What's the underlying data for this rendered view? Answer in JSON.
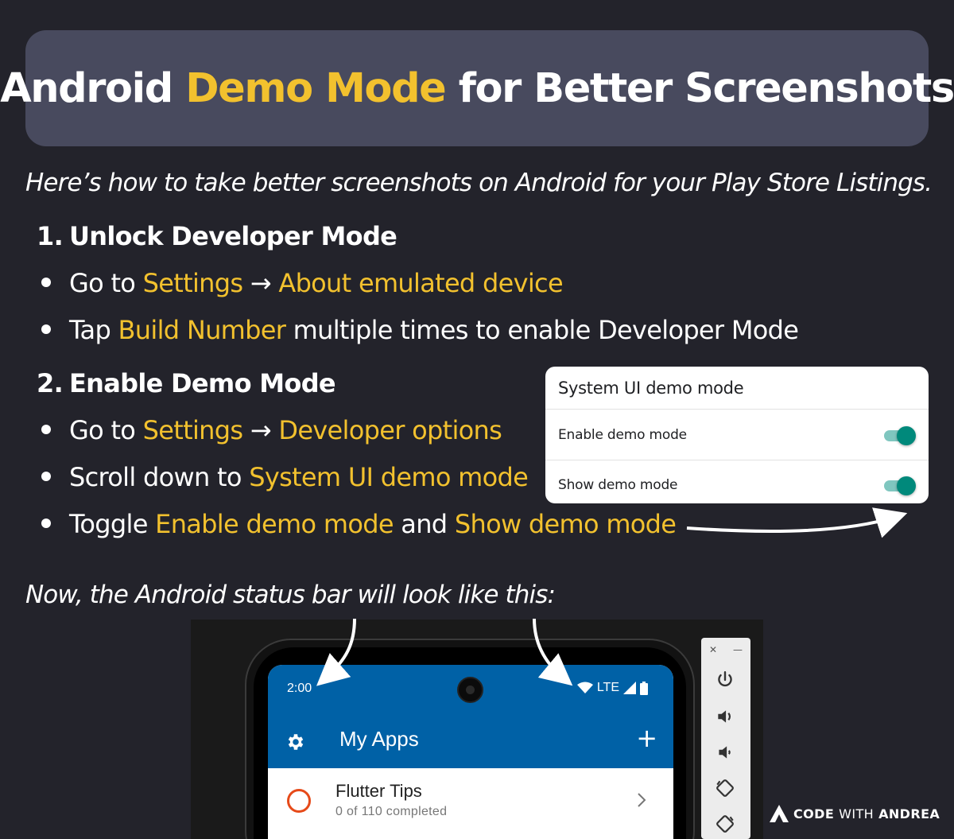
{
  "banner": {
    "title_pre": "Android ",
    "title_highlight": "Demo Mode",
    "title_post": " for Better Screenshots"
  },
  "intro": "Here’s how to take better screenshots on Android for your Play Store Listings.",
  "steps": [
    {
      "number": "1.",
      "title": "Unlock Developer Mode",
      "bullets": [
        {
          "p1": "Go to ",
          "h1": "Settings",
          "p2": " → ",
          "h2": "About emulated device"
        },
        {
          "p1": "Tap ",
          "h1": "Build Number",
          "p2": " multiple times to enable Developer Mode"
        }
      ]
    },
    {
      "number": "2.",
      "title": "Enable Demo Mode",
      "bullets": [
        {
          "p1": "Go to ",
          "h1": "Settings",
          "p2": " → ",
          "h2": "Developer options"
        },
        {
          "p1": "Scroll down to ",
          "h1": "System UI demo mode"
        },
        {
          "p1": "Toggle ",
          "h1": "Enable demo mode",
          "p2": " and ",
          "h2": "Show demo mode"
        }
      ]
    }
  ],
  "outro": "Now, the Android status bar will look like this:",
  "settings_card": {
    "header": "System UI demo mode",
    "rows": [
      {
        "label": "Enable demo mode",
        "enabled": true
      },
      {
        "label": "Show demo mode",
        "enabled": true
      }
    ]
  },
  "phone": {
    "status_time": "2:00",
    "network": "LTE",
    "app_title": "My Apps",
    "list_item": {
      "title": "Flutter Tips",
      "subtitle": "0 of 110 completed"
    }
  },
  "brand": {
    "part1": "CODE",
    "part2": "WITH",
    "part3": "ANDREA"
  },
  "colors": {
    "highlight": "#f2c12e",
    "background": "#23232b",
    "banner": "#484a5e",
    "appbar": "#0061a6",
    "toggle": "#00897b"
  }
}
